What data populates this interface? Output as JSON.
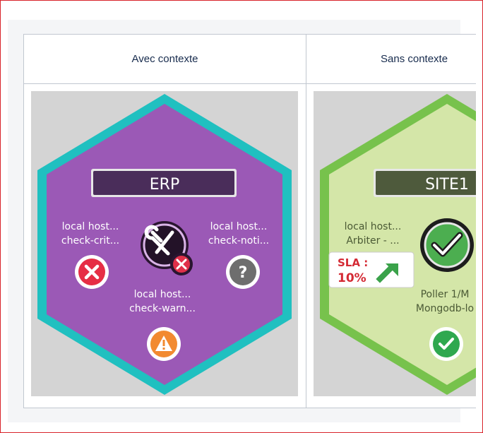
{
  "table": {
    "headers": [
      "Avec contexte",
      "Sans contexte"
    ]
  },
  "erp": {
    "title": "ERP",
    "left_service": {
      "line1": "local host...",
      "line2": "check-crit..."
    },
    "right_service": {
      "line1": "local host...",
      "line2": "check-noti..."
    },
    "bottom_service": {
      "line1": "local host...",
      "line2": "check-warn..."
    },
    "icons": {
      "center": "tools-icon",
      "overlay": "error-icon",
      "left": "critical-icon",
      "right": "unknown-icon",
      "bottom": "warning-icon"
    },
    "colors": {
      "hex_fill": "#9b59b6",
      "hex_border": "#20c0c0",
      "title_bg": "#4a2d5a"
    }
  },
  "site1": {
    "title": "SITE1",
    "left_service": {
      "line1": "local host...",
      "line2": "Arbiter - ..."
    },
    "bottom_service": {
      "line1": "Poller 1/M",
      "line2": "Mongodb-lo"
    },
    "sla": {
      "label": "SLA :",
      "value": "10%"
    },
    "icons": {
      "center": "check-circle-icon",
      "bottom": "ok-icon",
      "sla_arrow": "arrow-up-right-icon"
    },
    "colors": {
      "hex_fill": "#d4e6a8",
      "hex_border": "#77c24c",
      "title_bg": "#4e5a3c"
    }
  }
}
